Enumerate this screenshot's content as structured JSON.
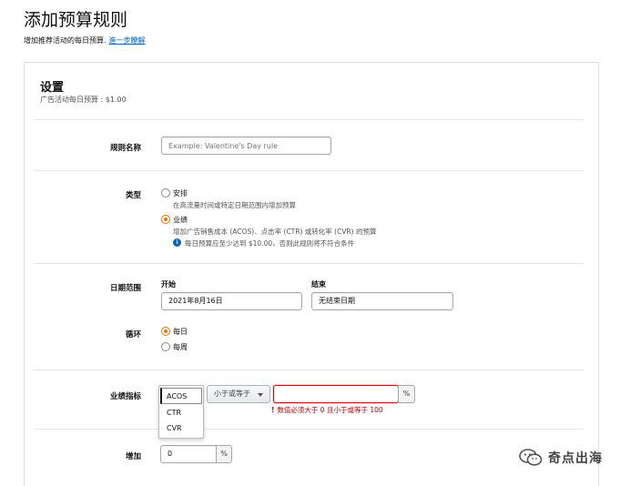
{
  "header": {
    "title": "添加预算规则",
    "subtitle": "增加推荐活动的每日预算.",
    "learn_more": "進一步瞭解"
  },
  "card": {
    "title": "设置",
    "subtitle": "广告活动每日预算 : $1.00"
  },
  "rule_name": {
    "label": "规则名称",
    "placeholder": "Example: Valentine's Day rule",
    "value": ""
  },
  "type": {
    "label": "类型",
    "options": [
      {
        "label": "安排",
        "desc": "在高流量时间或特定日期范围内增加预算",
        "selected": false
      },
      {
        "label": "业绩",
        "desc": "增加广告销售成本 (ACOS)、点击率 (CTR) 或转化率 (CVR) 的预算",
        "selected": true
      }
    ],
    "info_note": "每日预算应至少达到 $10.00，否则此规则将不符合条件"
  },
  "date_range": {
    "label": "日期范围",
    "start_label": "开始",
    "start_value": "2021年8月16日",
    "end_label": "结束",
    "end_value": "无结束日期"
  },
  "recurrence": {
    "label": "循环",
    "options": [
      {
        "label": "每日",
        "selected": true
      },
      {
        "label": "每周",
        "selected": false
      }
    ]
  },
  "metric": {
    "label": "业绩指标",
    "dropdown_options": [
      "ACOS",
      "CTR",
      "CVR"
    ],
    "selected_option": "ACOS",
    "comparator": "小于或等于",
    "value": "",
    "unit": "%",
    "error": "数值必须大于 0 且小于或等于 100"
  },
  "increase": {
    "label": "增加",
    "value": "0",
    "unit": "%"
  },
  "watermark": {
    "text": "奇点出海"
  },
  "colors": {
    "accent": "#e77600",
    "link": "#0066c0",
    "error": "#c40000"
  }
}
